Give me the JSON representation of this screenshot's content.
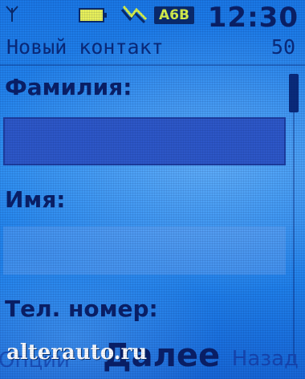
{
  "status_bar": {
    "signal_icon": "antenna-icon",
    "battery_icon": "battery-icon",
    "data_icon": "gprs-data-icon",
    "badge_text": "A6B",
    "time": "12:30"
  },
  "header": {
    "title": "Новый контакт",
    "counter": "50"
  },
  "form": {
    "fields": [
      {
        "label": "Фамилия:",
        "value": "",
        "active": true
      },
      {
        "label": "Имя:",
        "value": "",
        "active": false
      },
      {
        "label": "Тел. номер:",
        "value": "",
        "active": false
      }
    ]
  },
  "scrollbar": {
    "position_fraction": 0.0
  },
  "softkeys": {
    "left": "Опции",
    "center": "Далее",
    "right": "Назад"
  },
  "watermark": "alterauto.ru",
  "colors": {
    "background": "#2a8cf0",
    "text": "#0a1f66",
    "active_field": "#2d57c7",
    "badge_text": "#d9f24a"
  }
}
